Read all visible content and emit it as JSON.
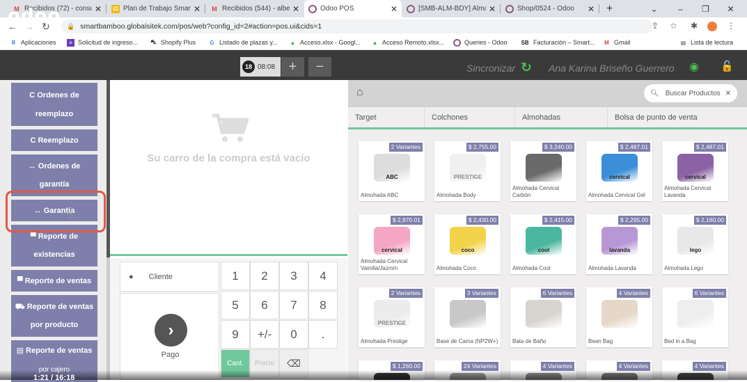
{
  "browser": {
    "tabs": [
      {
        "title": "Recibidos (72) - consu",
        "icon": "gmail-icon",
        "active": false
      },
      {
        "title": "Plan de Trabajo Smart",
        "icon": "docs-icon",
        "active": false
      },
      {
        "title": "Recibidos (544) - albe",
        "icon": "gmail-icon",
        "active": false
      },
      {
        "title": "Odoo POS",
        "icon": "odoo-icon",
        "active": true
      },
      {
        "title": "[SMB-ALM-BDY] Alma",
        "icon": "odoo-icon",
        "active": false
      },
      {
        "title": "Shop/0524 - Odoo",
        "icon": "odoo-icon",
        "active": false
      }
    ],
    "new_tab": "+",
    "window_controls": {
      "dropdown": "⌄",
      "minimize": "–",
      "restore": "❐",
      "close": "✕"
    },
    "url": "smartbamboo.globalsitek.com/pos/web?config_id=2#action=pos.ui&cids=1",
    "bookmarks": [
      {
        "label": "Aplicaciones",
        "icon": "apps-grid-icon"
      },
      {
        "label": "Solicitud de ingreso...",
        "icon": "form-icon"
      },
      {
        "label": "Shopify Plus",
        "icon": "shopify-icon"
      },
      {
        "label": "Listado de plazas y...",
        "icon": "google-icon"
      },
      {
        "label": "Acceso.xlsx - Googl...",
        "icon": "drive-icon"
      },
      {
        "label": "Acceso Remoto.xlsx...",
        "icon": "drive-icon"
      },
      {
        "label": "Queries - Odoo",
        "icon": "odoo-icon"
      },
      {
        "label": "Facturación – Smart...",
        "icon": "sb-icon"
      },
      {
        "label": "Gmail",
        "icon": "gmail-icon"
      }
    ],
    "reading_list": "Lista de lectura"
  },
  "pos": {
    "logo": "odoo",
    "order_number": "18",
    "order_time": "08:08",
    "add_order": "+",
    "remove_order": "−",
    "sync_label": "Sincronizar",
    "cashier": "Ana Karina Briseño Guerrero"
  },
  "sidebar": {
    "buttons": [
      {
        "icon": "C",
        "line1": "Ordenes de",
        "line2": "reemplazo"
      },
      {
        "icon": "C",
        "line1": "Reemplazo",
        "line2": ""
      },
      {
        "icon": "↔",
        "line1": "Ordenes de",
        "line2": "garantía"
      },
      {
        "icon": "↔",
        "line1": "Garantía",
        "line2": ""
      },
      {
        "icon": "▀",
        "line1": "Reporte de",
        "line2": "existencias"
      },
      {
        "icon": "▀",
        "line1": "Reporte de ventas",
        "line2": ""
      },
      {
        "icon": "⛟",
        "line1": "Reporte de ventas",
        "line2": "por producto"
      },
      {
        "icon": "▤",
        "line1": "Reporte de ventas",
        "line2": "por cajero"
      }
    ]
  },
  "cart": {
    "empty_text": "Su carro de la compra está vacío"
  },
  "numpad": {
    "client_label": "Cliente",
    "pay_label": "Pago",
    "keys": [
      "1",
      "2",
      "3",
      "4",
      "5",
      "6",
      "7",
      "8",
      "9",
      "+/-",
      "0",
      "."
    ],
    "modes": [
      "Cant.",
      "Precio",
      "⌫"
    ]
  },
  "products_panel": {
    "search_placeholder": "Buscar Productos",
    "categories": [
      "Target",
      "Colchones",
      "Almohadas",
      "Bolsa de punto de venta"
    ],
    "products": [
      {
        "badge": "2 Variantes",
        "name": "Almohada ABC",
        "brand": "ABC",
        "brand_color": "#222222",
        "color": "#dddddd"
      },
      {
        "badge": "$ 2,755.00",
        "name": "Almohada Body",
        "brand": "PRESTIGE",
        "brand_color": "#888888",
        "color": "#f0f0f0"
      },
      {
        "badge": "$ 3,240.00",
        "name": "Almohada Cervical Carbón",
        "brand": "",
        "brand_color": "#222222",
        "color": "#6a6a6a"
      },
      {
        "badge": "$ 2,487.01",
        "name": "Almohada Cervical Gel",
        "brand": "cervical",
        "brand_color": "#222222",
        "color": "#3b8fd9"
      },
      {
        "badge": "$ 2,487.01",
        "name": "Almohada Cervical Lavanda",
        "brand": "cervical",
        "brand_color": "#222222",
        "color": "#8b63a5"
      },
      {
        "badge": "$ 2,970.01",
        "name": "Almohada Cervical Vainilla/Jazmín",
        "brand": "cervical",
        "brand_color": "#222222",
        "color": "#f4a6c4"
      },
      {
        "badge": "$ 2,430.00",
        "name": "Almohada Coco",
        "brand": "coco",
        "brand_color": "#222222",
        "color": "#f2d34a"
      },
      {
        "badge": "$ 2,415.00",
        "name": "Almohada Cool",
        "brand": "cool",
        "brand_color": "#222222",
        "color": "#4bb7a0"
      },
      {
        "badge": "$ 2,295.00",
        "name": "Almohada Lavanda",
        "brand": "lavanda",
        "brand_color": "#222222",
        "color": "#b897d6"
      },
      {
        "badge": "$ 2,160.00",
        "name": "Almohada Lego",
        "brand": "lego",
        "brand_color": "#222222",
        "color": "#e8e8e8"
      },
      {
        "badge": "2 Variantes",
        "name": "Almohada Prestige",
        "brand": "PRESTIGE",
        "brand_color": "#888888",
        "color": "#ececec"
      },
      {
        "badge": "3 Variantes",
        "name": "Base de Cama (NP2W+)",
        "brand": "",
        "brand_color": "#222222",
        "color": "#c8c8c8"
      },
      {
        "badge": "6 Variantes",
        "name": "Bata de Baño",
        "brand": "",
        "brand_color": "#222222",
        "color": "#d8d4d0"
      },
      {
        "badge": "4 Variantes",
        "name": "Bean Bag",
        "brand": "",
        "brand_color": "#222222",
        "color": "#e6d8c8"
      },
      {
        "badge": "6 Variantes",
        "name": "Bed in a Bag",
        "brand": "",
        "brand_color": "#222222",
        "color": "#eeeeee"
      },
      {
        "badge": "$ 1,260.00",
        "name": "",
        "brand": "",
        "brand_color": "#222222",
        "color": "#333333"
      },
      {
        "badge": "24 Variantes",
        "name": "",
        "brand": "",
        "brand_color": "#222222",
        "color": "#999999"
      },
      {
        "badge": "4 Variantes",
        "name": "",
        "brand": "",
        "brand_color": "#222222",
        "color": "#888888"
      },
      {
        "badge": "4 Variantes",
        "name": "",
        "brand": "",
        "brand_color": "#222222",
        "color": "#777777"
      },
      {
        "badge": "4 Variantes",
        "name": "",
        "brand": "",
        "brand_color": "#222222",
        "color": "#444444"
      }
    ]
  },
  "video": {
    "time": "1:21 / 16:18"
  },
  "colors": {
    "accent": "#7f7fab",
    "green": "#6ec89b",
    "header": "#3a3a3a",
    "highlight": "#e05a46"
  }
}
